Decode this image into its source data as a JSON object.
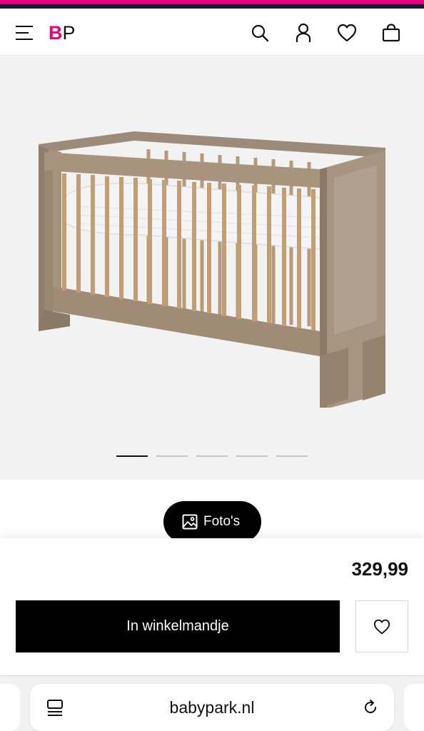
{
  "header": {
    "logo_b": "B",
    "logo_p": "P",
    "icons": [
      "menu-icon",
      "search-icon",
      "account-icon",
      "heart-icon",
      "bag-icon"
    ]
  },
  "gallery": {
    "image": "crib-product-photo",
    "slide_count": 5,
    "active_slide": 1
  },
  "photos_button": {
    "label": "Foto's",
    "icon": "image-icon"
  },
  "product": {
    "price": "329,99",
    "add_to_cart_label": "In winkelmandje",
    "wishlist_icon": "heart-icon"
  },
  "browser": {
    "url": "babypark.nl",
    "icons": [
      "tabs-icon",
      "reload-icon"
    ]
  },
  "colors": {
    "brand_pink": "#e6007e",
    "primary_button": "#000000",
    "gallery_bg": "#f2f2f2"
  }
}
